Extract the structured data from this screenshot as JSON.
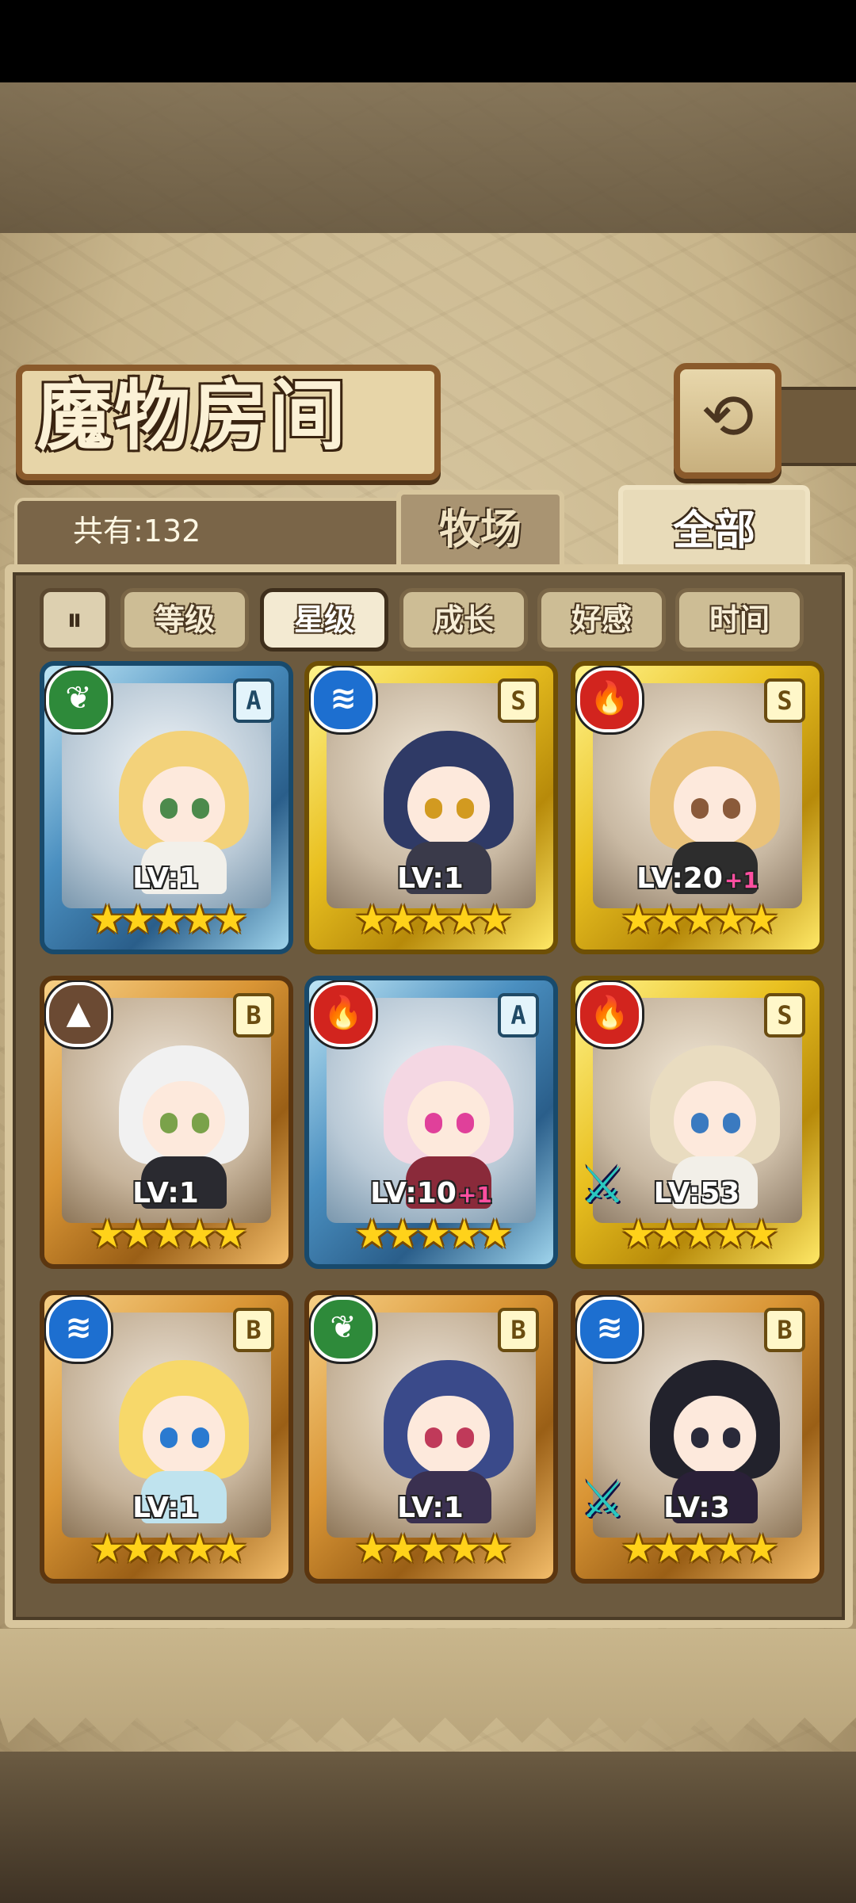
{
  "title": "魔物房间",
  "back_button_label": "⟲",
  "count": "共有:132",
  "tabs": [
    {
      "label": "牧场",
      "active": false
    },
    {
      "label": "全部",
      "active": true
    }
  ],
  "sort_toggle_icon": "sort-direction-icon",
  "sort_buttons": [
    {
      "label": "等级",
      "active": false
    },
    {
      "label": "星级",
      "active": true
    },
    {
      "label": "成长",
      "active": false
    },
    {
      "label": "好感",
      "active": false
    },
    {
      "label": "时间",
      "active": false
    }
  ],
  "cards": [
    {
      "level": "LV:1",
      "bonus": "",
      "rank": "A",
      "element": "leaf",
      "element_glyph": "❦",
      "frame": "blue",
      "stars": "★★★★★",
      "equipment": false
    },
    {
      "level": "LV:1",
      "bonus": "",
      "rank": "S",
      "element": "water",
      "element_glyph": "≋",
      "frame": "gold",
      "stars": "★★★★★",
      "equipment": false
    },
    {
      "level": "LV:20",
      "bonus": "+1",
      "rank": "S",
      "element": "fire",
      "element_glyph": "🔥",
      "frame": "gold",
      "stars": "★★★★★",
      "equipment": false
    },
    {
      "level": "LV:1",
      "bonus": "",
      "rank": "B",
      "element": "earth",
      "element_glyph": "▲",
      "frame": "bronze",
      "stars": "★★★★★",
      "equipment": false
    },
    {
      "level": "LV:10",
      "bonus": "+1",
      "rank": "A",
      "element": "fire",
      "element_glyph": "🔥",
      "frame": "blue",
      "stars": "★★★★★",
      "equipment": false
    },
    {
      "level": "LV:53",
      "bonus": "",
      "rank": "S",
      "element": "fire",
      "element_glyph": "🔥",
      "frame": "gold",
      "stars": "★★★★★",
      "equipment": true
    },
    {
      "level": "LV:1",
      "bonus": "",
      "rank": "B",
      "element": "water",
      "element_glyph": "≋",
      "frame": "bronze",
      "stars": "★★★★★",
      "equipment": false
    },
    {
      "level": "LV:1",
      "bonus": "",
      "rank": "B",
      "element": "leaf",
      "element_glyph": "❦",
      "frame": "bronze",
      "stars": "★★★★★",
      "equipment": false
    },
    {
      "level": "LV:3",
      "bonus": "",
      "rank": "B",
      "element": "water",
      "element_glyph": "≋",
      "frame": "bronze",
      "stars": "★★★★★",
      "equipment": true
    }
  ],
  "colors": {
    "fire": "#d2241e",
    "water": "#1d6fd0",
    "leaf": "#2e8a3a",
    "earth": "#6b4a33",
    "bonus": "#ff4fa0"
  }
}
